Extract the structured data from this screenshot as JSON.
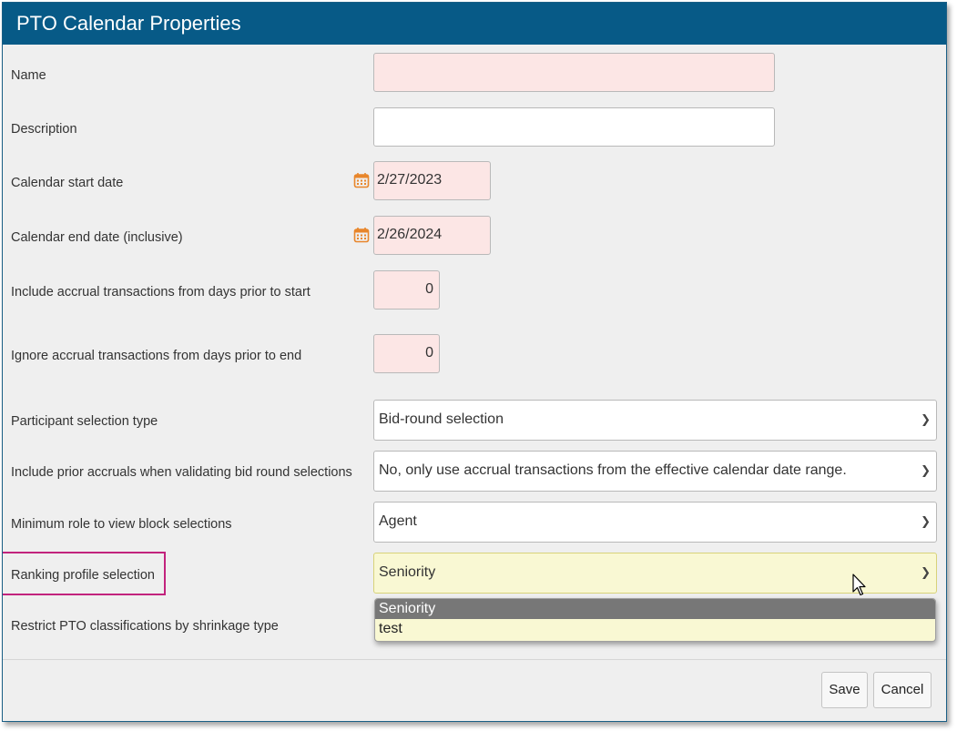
{
  "dialog": {
    "title": "PTO Calendar Properties"
  },
  "form": {
    "name": {
      "label": "Name",
      "value": ""
    },
    "description": {
      "label": "Description",
      "value": ""
    },
    "start_date": {
      "label": "Calendar start date",
      "value": "2/27/2023",
      "icon": "calendar-icon"
    },
    "end_date": {
      "label": "Calendar end date (inclusive)",
      "value": "2/26/2024",
      "icon": "calendar-icon"
    },
    "accrual_prior_start": {
      "label": "Include accrual transactions from days prior to start",
      "value": "0"
    },
    "accrual_prior_end": {
      "label": "Ignore accrual transactions from days prior to end",
      "value": "0"
    },
    "participant_type": {
      "label": "Participant selection type",
      "value": "Bid-round selection"
    },
    "prior_accruals": {
      "label": "Include prior accruals when validating bid round selections",
      "value": "No, only use accrual transactions from the effective calendar date range."
    },
    "min_role": {
      "label": "Minimum role to view block selections",
      "value": "Agent"
    },
    "ranking_profile": {
      "label": "Ranking profile selection",
      "value": "Seniority",
      "options": [
        "Seniority",
        "test"
      ],
      "highlighted_option": "Seniority"
    },
    "restrict_pto": {
      "label": "Restrict PTO classifications by shrinkage type"
    }
  },
  "footer": {
    "save_label": "Save",
    "cancel_label": "Cancel"
  },
  "colors": {
    "titlebar": "#075a87",
    "required_field_bg": "#fce6e5",
    "focused_field_bg": "#f9f8d3",
    "highlight_border": "#c2237d",
    "calendar_icon": "#e8862b"
  }
}
